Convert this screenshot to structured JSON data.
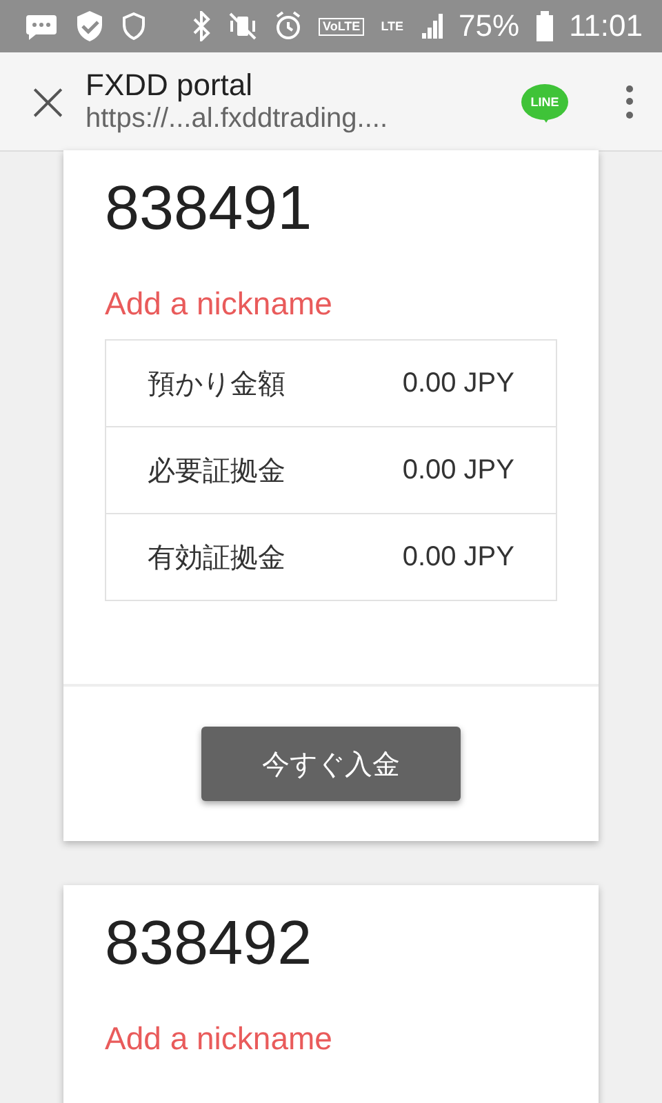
{
  "status_bar": {
    "volte": "VoLTE",
    "network": "LTE",
    "battery": "75%",
    "time": "11:01"
  },
  "toolbar": {
    "close": "×",
    "title": "FXDD portal",
    "url": "https://...al.fxddtrading....",
    "share_logo": "LINE"
  },
  "accounts": [
    {
      "number": "838491",
      "nickname_link": "Add a nickname",
      "balances": [
        {
          "label": "預かり金額",
          "value": "0.00 JPY"
        },
        {
          "label": "必要証拠金",
          "value": "0.00 JPY"
        },
        {
          "label": "有効証拠金",
          "value": "0.00 JPY"
        }
      ],
      "button": "今すぐ入金"
    },
    {
      "number": "838492",
      "nickname_link": "Add a nickname"
    }
  ]
}
